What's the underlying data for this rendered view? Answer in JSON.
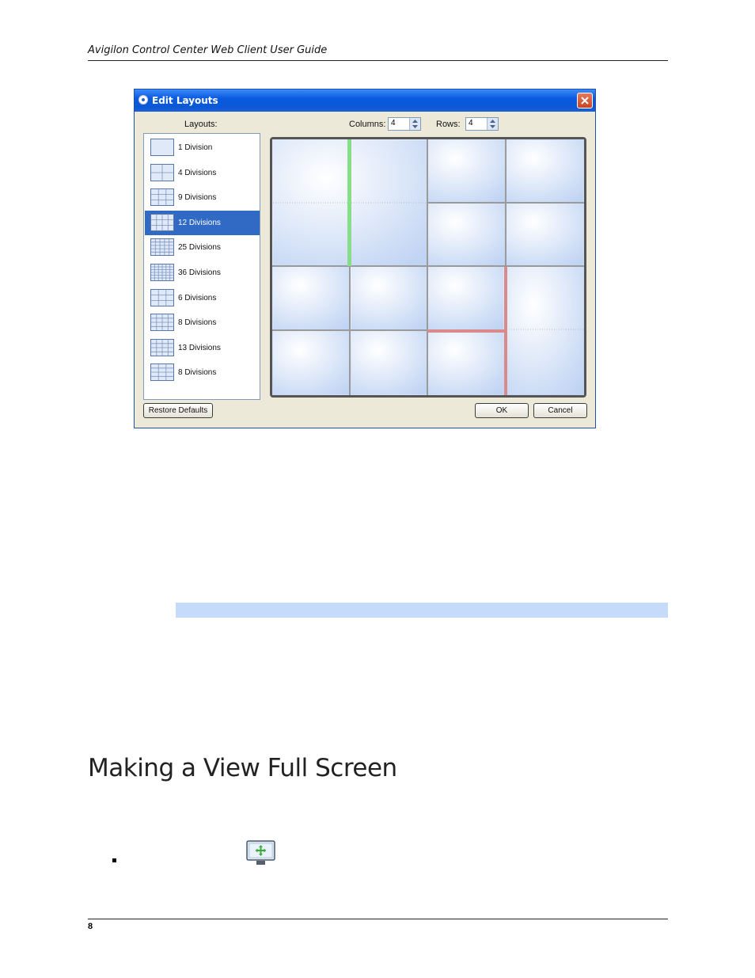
{
  "header": {
    "title": "Avigilon Control Center Web Client User Guide"
  },
  "dialog": {
    "title": "Edit Layouts",
    "layouts_label": "Layouts:",
    "columns_label": "Columns:",
    "columns_value": "4",
    "rows_label": "Rows:",
    "rows_value": "4",
    "layouts": [
      {
        "label": "1 Division",
        "selected": false
      },
      {
        "label": "4 Divisions",
        "selected": false
      },
      {
        "label": "9 Divisions",
        "selected": false
      },
      {
        "label": "12 Divisions",
        "selected": true
      },
      {
        "label": "25 Divisions",
        "selected": false
      },
      {
        "label": "36 Divisions",
        "selected": false
      },
      {
        "label": "6 Divisions",
        "selected": false
      },
      {
        "label": "8 Divisions",
        "selected": false
      },
      {
        "label": "13 Divisions",
        "selected": false
      },
      {
        "label": "8 Divisions",
        "selected": false
      }
    ],
    "restore_defaults_label": "Restore Defaults",
    "ok_label": "OK",
    "cancel_label": "Cancel"
  },
  "section": {
    "heading": "Making a View Full Screen"
  },
  "footer": {
    "page_number": "8"
  }
}
